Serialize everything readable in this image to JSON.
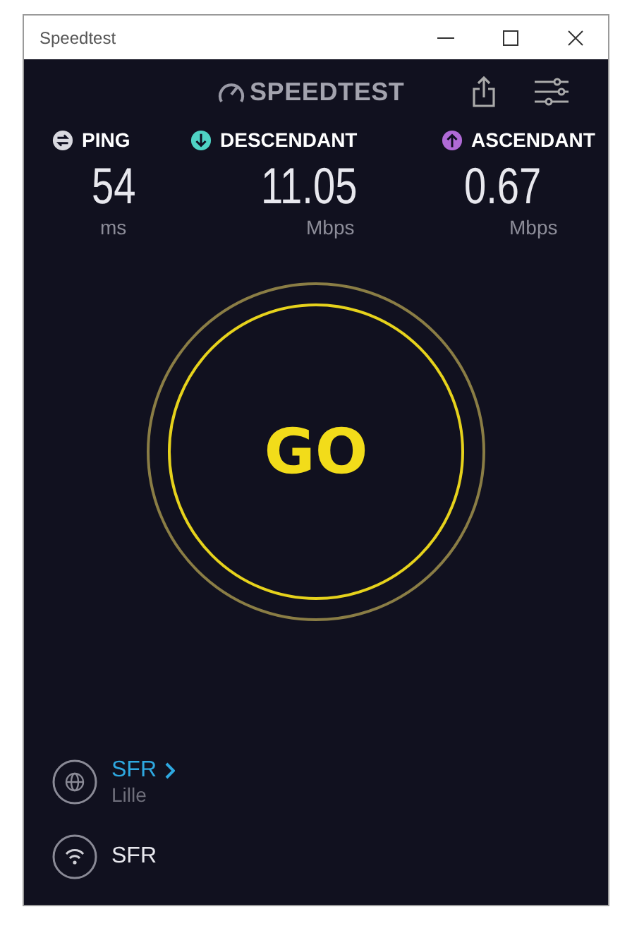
{
  "window": {
    "title": "Speedtest"
  },
  "brand": {
    "name": "SPEEDTEST"
  },
  "metrics": [
    {
      "kind": "ping",
      "label": "PING",
      "value": "54",
      "unit": "ms",
      "color": "#d9d9e0"
    },
    {
      "kind": "download",
      "label": "DESCENDANT",
      "value": "11.05",
      "unit": "Mbps",
      "color": "#4fd3c4"
    },
    {
      "kind": "upload",
      "label": "ASCENDANT",
      "value": "0.67",
      "unit": "Mbps",
      "color": "#b06ad6"
    }
  ],
  "go_button": {
    "label": "GO"
  },
  "server": {
    "provider": "SFR",
    "location": "Lille"
  },
  "connection": {
    "name": "SFR"
  }
}
